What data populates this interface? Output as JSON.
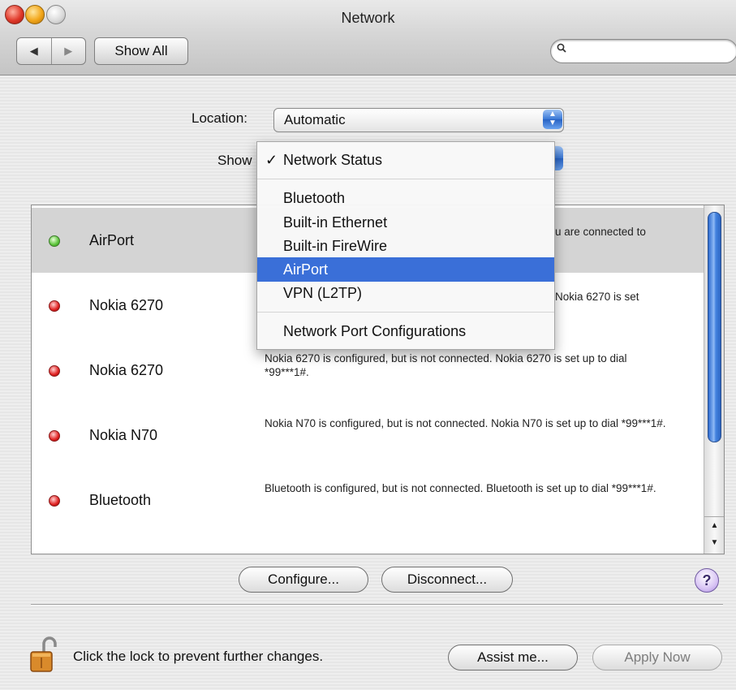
{
  "window": {
    "title": "Network"
  },
  "toolbar": {
    "back_glyph": "◀",
    "forward_glyph": "▶",
    "show_all_label": "Show All",
    "search_value": ""
  },
  "location": {
    "label": "Location:",
    "value": "Automatic"
  },
  "show": {
    "label": "Show",
    "selected": "Network Status"
  },
  "dropdown": {
    "checked": "Network Status",
    "checkmark": "✓",
    "items": [
      "Bluetooth",
      "Built-in Ethernet",
      "Built-in FireWire",
      "AirPort",
      "VPN (L2TP)"
    ],
    "highlighted": "AirPort",
    "footer_item": "Network Port Configurations"
  },
  "services": [
    {
      "name": "AirPort",
      "status": "connected",
      "status_color": "#5bc43a",
      "description": "AirPort is connected to the network linksys. You are connected to the Internet via AirPort.",
      "description_visible": "u are connected to"
    },
    {
      "name": "Nokia 6270",
      "status": "not-connected",
      "status_color": "#e02020",
      "description": "Nokia 6270 is configured, but is not connected. Nokia 6270 is set up to dial *99***1#.",
      "description_visible": "Nokia 6270 is set"
    },
    {
      "name": "Nokia 6270",
      "status": "not-connected",
      "status_color": "#e02020",
      "description": "Nokia 6270 is configured, but is not connected. Nokia 6270 is set up to dial *99***1#."
    },
    {
      "name": "Nokia N70",
      "status": "not-connected",
      "status_color": "#e02020",
      "description": "Nokia N70 is configured, but is not connected. Nokia N70 is set up to dial *99***1#."
    },
    {
      "name": "Bluetooth",
      "status": "not-connected",
      "status_color": "#e02020",
      "description": "Bluetooth is configured, but is not connected. Bluetooth is set up to dial *99***1#."
    }
  ],
  "buttons": {
    "configure": "Configure...",
    "disconnect": "Disconnect...",
    "help": "?",
    "assist": "Assist me...",
    "apply": "Apply Now"
  },
  "lock": {
    "text": "Click the lock to prevent further changes."
  },
  "colors": {
    "selection": "#3a6fd8",
    "row_selected": "#d4d4d4"
  }
}
